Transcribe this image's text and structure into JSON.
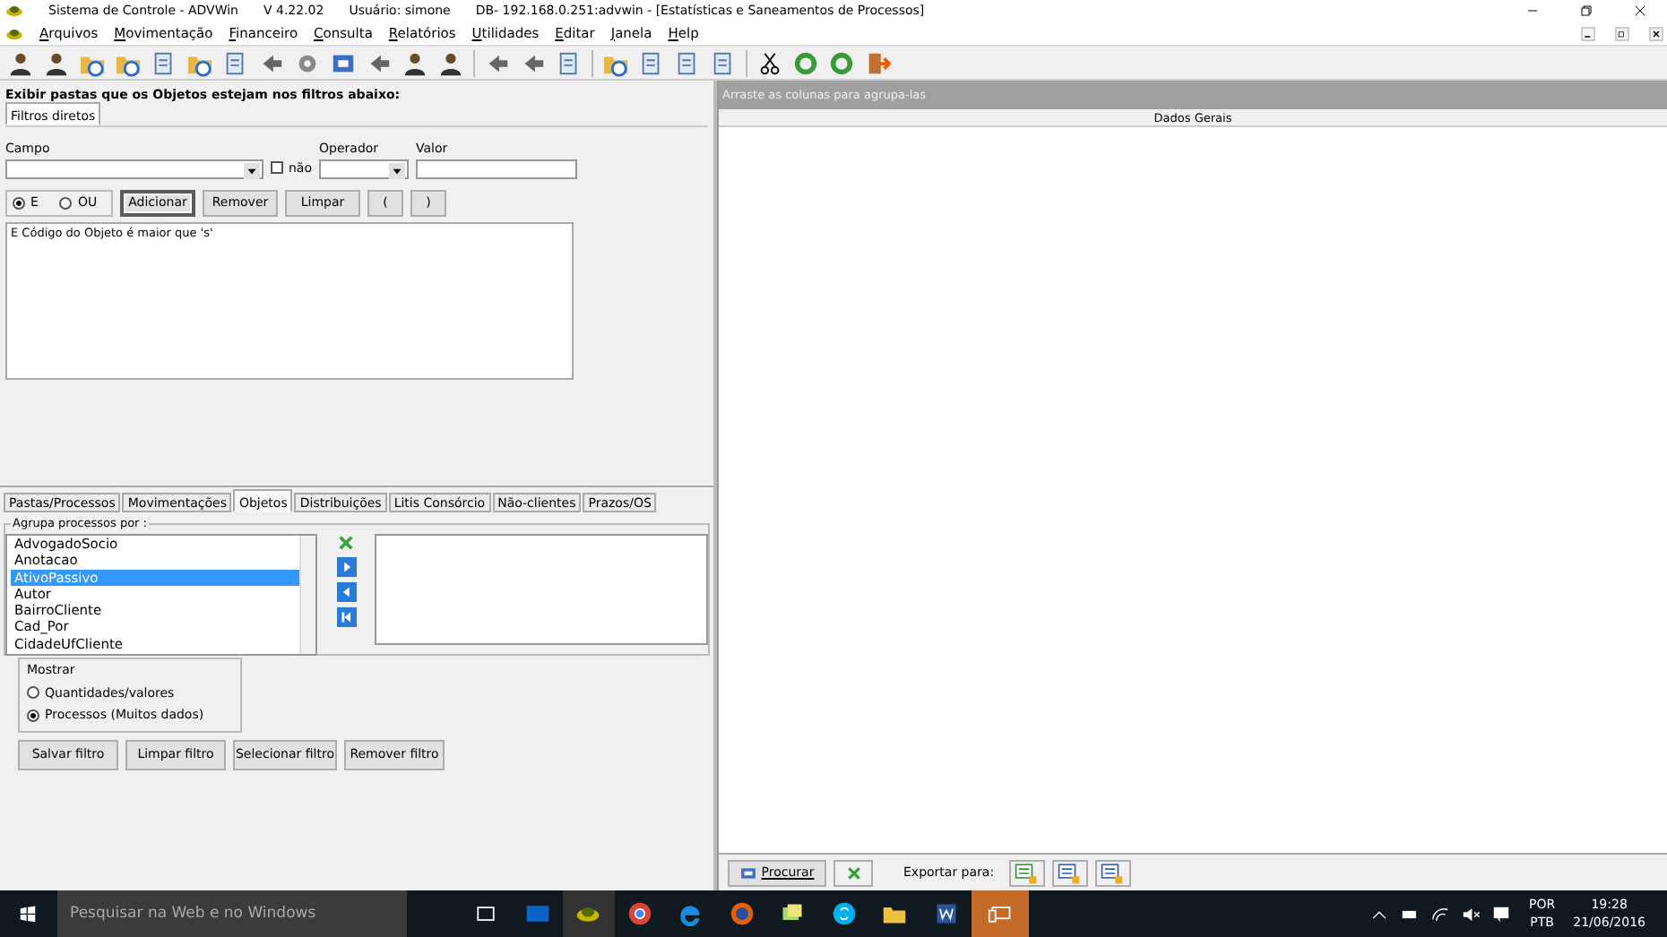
{
  "window": {
    "title": "Sistema de Controle - ADVWin",
    "version": "V 4.22.02",
    "user": "Usuário: simone",
    "db": "DB- 192.168.0.251:advwin - [Estatísticas e Saneamentos de Processos]"
  },
  "menu": [
    "Arquivos",
    "Movimentação",
    "Financeiro",
    "Consulta",
    "Relatórios",
    "Utilidades",
    "Editar",
    "Janela",
    "Help"
  ],
  "filter": {
    "heading": "Exibir pastas que os Objetos estejam nos filtros abaixo:",
    "tab": "Filtros diretos",
    "field_label": "Campo",
    "negate": {
      "label": "não",
      "checked": false
    },
    "operator_label": "Operador",
    "value_label": "Valor",
    "logic": [
      {
        "label": "E",
        "selected": true
      },
      {
        "label": "OU",
        "selected": false
      }
    ],
    "buttons": [
      {
        "label": "Adicionar",
        "default": true
      },
      {
        "label": "Remover",
        "default": false
      },
      {
        "label": "Limpar",
        "default": false
      },
      {
        "label": "(",
        "default": false
      },
      {
        "label": ")",
        "default": false
      }
    ],
    "expression": "E Código do Objeto  é maior que 's'"
  },
  "tabs": [
    {
      "label": "Pastas/Processos",
      "selected": false
    },
    {
      "label": "Movimentações",
      "selected": false
    },
    {
      "label": "Objetos",
      "selected": true
    },
    {
      "label": "Distribuições",
      "selected": false
    },
    {
      "label": "Litis Consórcio",
      "selected": false
    },
    {
      "label": "Não-clientes",
      "selected": false
    },
    {
      "label": "Prazos/OS",
      "selected": false
    }
  ],
  "group": {
    "legend": "Agrupa processos por :",
    "items": [
      {
        "label": "AdvogadoSocio",
        "selected": false
      },
      {
        "label": "Anotacao",
        "selected": false
      },
      {
        "label": "AtivoPassivo",
        "selected": true
      },
      {
        "label": "Autor",
        "selected": false
      },
      {
        "label": "BairroCliente",
        "selected": false
      },
      {
        "label": "Cad_Por",
        "selected": false
      },
      {
        "label": "CidadeUfCliente",
        "selected": false
      }
    ]
  },
  "show": {
    "legend": "Mostrar",
    "options": [
      {
        "label": "Quantidades/valores",
        "selected": false
      },
      {
        "label": "Processos (Muitos dados)",
        "selected": true
      }
    ]
  },
  "filter_buttons": [
    "Salvar filtro",
    "Limpar filtro",
    "Selecionar filtro",
    "Remover filtro"
  ],
  "grid": {
    "group_hint": "Arraste as colunas para agrupa-las",
    "header": "Dados Gerais"
  },
  "footer": {
    "search_button": "Procurar",
    "export_label": "Exportar para:"
  },
  "taskbar": {
    "search_placeholder": "Pesquisar na Web e no Windows",
    "lang": "POR",
    "layout": "PTB",
    "time": "19:28",
    "date": "21/06/2016"
  }
}
